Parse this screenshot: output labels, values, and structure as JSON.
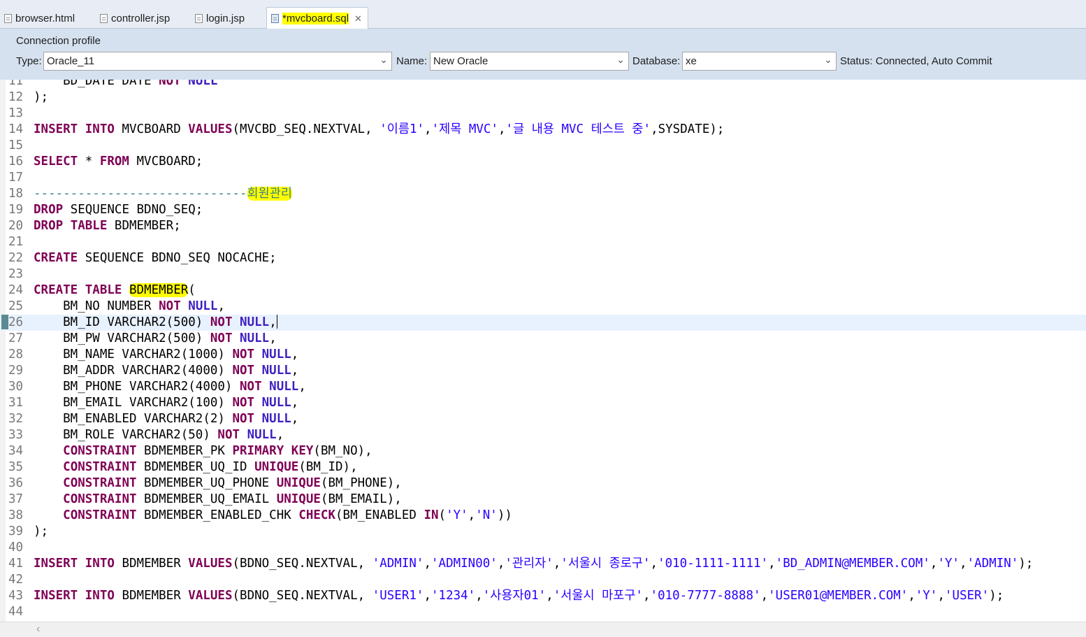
{
  "tabs": [
    {
      "label": "browser.html",
      "active": false
    },
    {
      "label": "controller.jsp",
      "active": false
    },
    {
      "label": "login.jsp",
      "active": false
    },
    {
      "label": "*mvcboard.sql",
      "active": true
    }
  ],
  "connection_profile": {
    "title": "Connection profile",
    "type_label": "Type:",
    "type_value": "Oracle_11",
    "name_label": "Name:",
    "name_value": "New Oracle",
    "database_label": "Database:",
    "database_value": "xe",
    "status": "Status: Connected, Auto Commit"
  },
  "editor": {
    "lines": [
      {
        "n": "11",
        "text": "    BD_DATE DATE NOT NULL"
      },
      {
        "n": "12",
        "text": ");"
      },
      {
        "n": "13",
        "text": ""
      },
      {
        "n": "14",
        "text": "INSERT INTO MVCBOARD VALUES(MVCBD_SEQ.NEXTVAL, '이름1','제목 MVC','글 내용 MVC 테스트 중',SYSDATE);"
      },
      {
        "n": "15",
        "text": ""
      },
      {
        "n": "16",
        "text": "SELECT * FROM MVCBOARD;"
      },
      {
        "n": "17",
        "text": ""
      },
      {
        "n": "18",
        "text": "-----------------------------회원관리"
      },
      {
        "n": "19",
        "text": "DROP SEQUENCE BDNO_SEQ;"
      },
      {
        "n": "20",
        "text": "DROP TABLE BDMEMBER;"
      },
      {
        "n": "21",
        "text": ""
      },
      {
        "n": "22",
        "text": "CREATE SEQUENCE BDNO_SEQ NOCACHE;"
      },
      {
        "n": "23",
        "text": ""
      },
      {
        "n": "24",
        "text": "CREATE TABLE BDMEMBER("
      },
      {
        "n": "25",
        "text": "    BM_NO NUMBER NOT NULL,"
      },
      {
        "n": "26",
        "text": "    BM_ID VARCHAR2(500) NOT NULL,"
      },
      {
        "n": "27",
        "text": "    BM_PW VARCHAR2(500) NOT NULL,"
      },
      {
        "n": "28",
        "text": "    BM_NAME VARCHAR2(1000) NOT NULL,"
      },
      {
        "n": "29",
        "text": "    BM_ADDR VARCHAR2(4000) NOT NULL,"
      },
      {
        "n": "30",
        "text": "    BM_PHONE VARCHAR2(4000) NOT NULL,"
      },
      {
        "n": "31",
        "text": "    BM_EMAIL VARCHAR2(100) NOT NULL,"
      },
      {
        "n": "32",
        "text": "    BM_ENABLED VARCHAR2(2) NOT NULL,"
      },
      {
        "n": "33",
        "text": "    BM_ROLE VARCHAR2(50) NOT NULL,"
      },
      {
        "n": "34",
        "text": "    CONSTRAINT BDMEMBER_PK PRIMARY KEY(BM_NO),"
      },
      {
        "n": "35",
        "text": "    CONSTRAINT BDMEMBER_UQ_ID UNIQUE(BM_ID),"
      },
      {
        "n": "36",
        "text": "    CONSTRAINT BDMEMBER_UQ_PHONE UNIQUE(BM_PHONE),"
      },
      {
        "n": "37",
        "text": "    CONSTRAINT BDMEMBER_UQ_EMAIL UNIQUE(BM_EMAIL),"
      },
      {
        "n": "38",
        "text": "    CONSTRAINT BDMEMBER_ENABLED_CHK CHECK(BM_ENABLED IN('Y','N'))"
      },
      {
        "n": "39",
        "text": ");"
      },
      {
        "n": "40",
        "text": ""
      },
      {
        "n": "41",
        "text": "INSERT INTO BDMEMBER VALUES(BDNO_SEQ.NEXTVAL, 'ADMIN','ADMIN00','관리자','서울시 종로구','010-1111-1111','BD_ADMIN@MEMBER.COM','Y','ADMIN');"
      },
      {
        "n": "42",
        "text": ""
      },
      {
        "n": "43",
        "text": "INSERT INTO BDMEMBER VALUES(BDNO_SEQ.NEXTVAL, 'USER1','1234','사용자01','서울시 마포구','010-7777-8888','USER01@MEMBER.COM','Y','USER');"
      },
      {
        "n": "44",
        "text": ""
      }
    ],
    "current_line": "26"
  },
  "colors": {
    "keyword": "#7f0055",
    "keyword_null": "#3f1fbf",
    "string": "#2a00ff",
    "comment": "#3f7f7f",
    "highlight": "#ffff00",
    "current_line_bg": "#e8f2fe"
  }
}
